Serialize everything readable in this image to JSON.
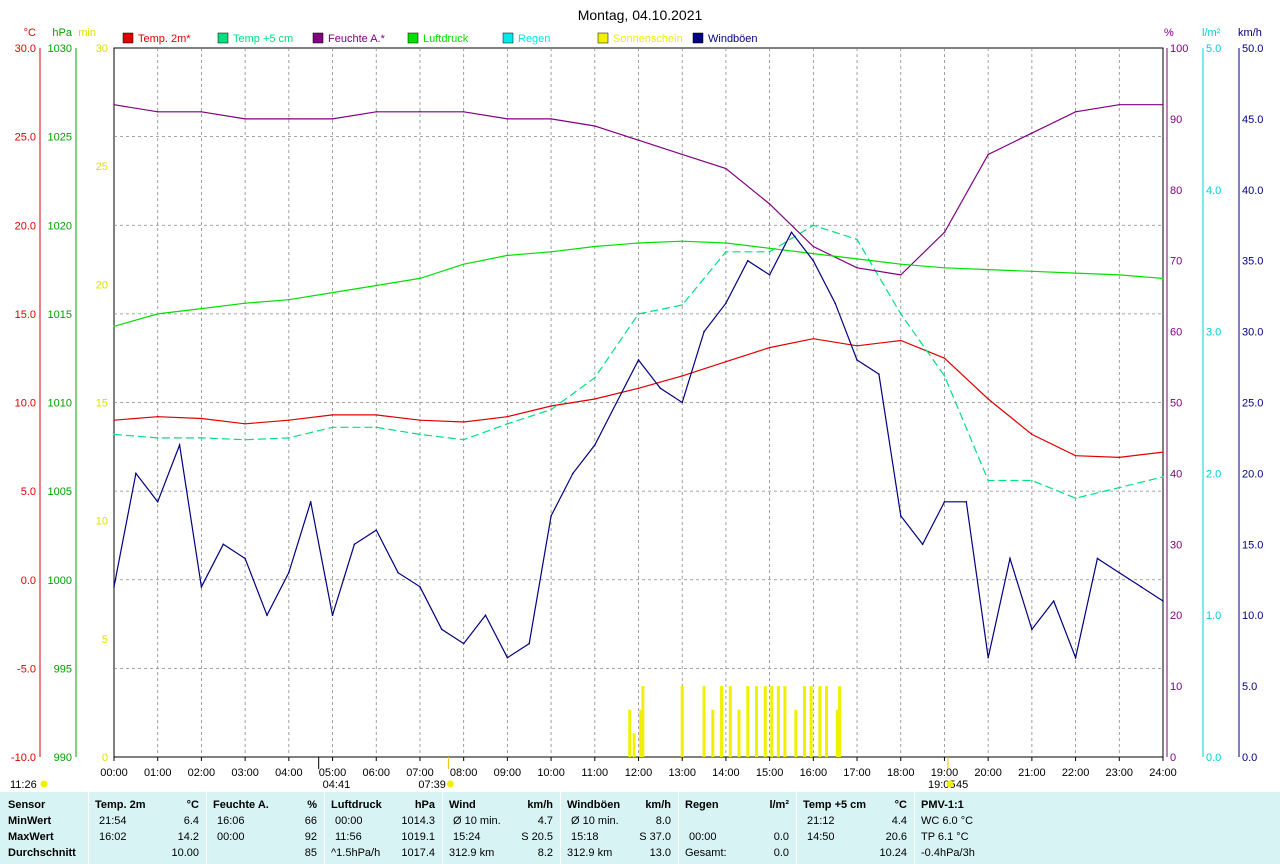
{
  "title": "Montag, 04.10.2021",
  "legend": [
    {
      "label": "Temp. 2m*",
      "color": "#e00000"
    },
    {
      "label": "Temp +5 cm",
      "color": "#00e080"
    },
    {
      "label": "Feuchte A.*",
      "color": "#800080"
    },
    {
      "label": "Luftdruck",
      "color": "#00e000"
    },
    {
      "label": "Regen",
      "color": "#00e8e8"
    },
    {
      "label": "Sonnenschein",
      "color": "#f0f000"
    },
    {
      "label": "Windböen",
      "color": "#000080"
    }
  ],
  "axes": {
    "temp": {
      "unit": "°C",
      "ticks": [
        "30.0",
        "25.0",
        "20.0",
        "15.0",
        "10.0",
        "5.0",
        "0.0",
        "-5.0",
        "-10.0"
      ],
      "color": "#e00000"
    },
    "pressure": {
      "unit": "hPa",
      "ticks": [
        "1030",
        "1025",
        "1020",
        "1015",
        "1010",
        "1005",
        "1000",
        "995",
        "990"
      ],
      "color": "#00a000"
    },
    "sun": {
      "unit": "min",
      "ticks": [
        "30",
        "25",
        "20",
        "15",
        "10",
        "5",
        "0"
      ],
      "color": "#e0e000"
    },
    "humidity": {
      "unit": "%",
      "ticks": [
        "100",
        "90",
        "80",
        "70",
        "60",
        "50",
        "40",
        "30",
        "20",
        "10",
        "0"
      ],
      "color": "#800080"
    },
    "rain": {
      "unit": "l/m²",
      "ticks": [
        "5.0",
        "4.0",
        "3.0",
        "2.0",
        "1.0",
        "0.0"
      ],
      "color": "#00d0d0"
    },
    "wind": {
      "unit": "km/h",
      "ticks": [
        "50.0",
        "45.0",
        "40.0",
        "35.0",
        "30.0",
        "25.0",
        "20.0",
        "15.0",
        "10.0",
        "5.0",
        "0.0"
      ],
      "color": "#000080"
    }
  },
  "x_labels": [
    "00:00",
    "01:00",
    "02:00",
    "03:00",
    "04:00",
    "05:00",
    "06:00",
    "07:00",
    "08:00",
    "09:00",
    "10:00",
    "11:00",
    "12:00",
    "13:00",
    "14:00",
    "15:00",
    "16:00",
    "17:00",
    "18:00",
    "19:00",
    "20:00",
    "21:00",
    "22:00",
    "23:00",
    "24:00"
  ],
  "sun_times": {
    "sunrise_label": "07:39",
    "sunset_label": "19:05",
    "moonrise_label": "04:41",
    "moonset_label": "45",
    "daylength_label": "11:26"
  },
  "chart_data": {
    "type": "line",
    "x_unit": "hour",
    "xlim": [
      0,
      24
    ],
    "series": [
      {
        "name": "Temp. 2m*",
        "axis": "temp",
        "x": [
          0,
          1,
          2,
          3,
          4,
          5,
          6,
          7,
          8,
          9,
          10,
          11,
          12,
          13,
          14,
          15,
          16,
          17,
          18,
          19,
          20,
          21,
          22,
          23,
          24
        ],
        "values": [
          9.0,
          9.2,
          9.1,
          8.8,
          9.0,
          9.3,
          9.3,
          9.0,
          8.9,
          9.2,
          9.8,
          10.2,
          10.8,
          11.5,
          12.3,
          13.1,
          13.6,
          13.2,
          13.5,
          12.5,
          10.2,
          8.2,
          7.0,
          6.9,
          7.2
        ]
      },
      {
        "name": "Temp +5 cm",
        "axis": "temp",
        "x": [
          0,
          1,
          2,
          3,
          4,
          5,
          6,
          7,
          8,
          9,
          10,
          11,
          12,
          13,
          14,
          15,
          16,
          17,
          18,
          19,
          20,
          21,
          22,
          23,
          24
        ],
        "values": [
          8.2,
          8.0,
          8.0,
          7.9,
          8.0,
          8.6,
          8.6,
          8.2,
          7.9,
          8.8,
          9.6,
          11.4,
          15.0,
          15.5,
          18.5,
          18.5,
          20.0,
          19.2,
          15.0,
          11.5,
          5.6,
          5.6,
          4.6,
          5.2,
          5.8
        ]
      },
      {
        "name": "Feuchte A.*",
        "axis": "humidity",
        "x": [
          0,
          1,
          2,
          3,
          4,
          5,
          6,
          7,
          8,
          9,
          10,
          11,
          12,
          13,
          14,
          15,
          16,
          17,
          18,
          19,
          20,
          21,
          22,
          23,
          24
        ],
        "values": [
          92,
          91,
          91,
          90,
          90,
          90,
          91,
          91,
          91,
          90,
          90,
          89,
          87,
          85,
          83,
          78,
          72,
          69,
          68,
          74,
          85,
          88,
          91,
          92,
          92
        ]
      },
      {
        "name": "Luftdruck",
        "axis": "pressure",
        "x": [
          0,
          1,
          2,
          3,
          4,
          5,
          6,
          7,
          8,
          9,
          10,
          11,
          12,
          13,
          14,
          15,
          16,
          17,
          18,
          19,
          20,
          21,
          22,
          23,
          24
        ],
        "values": [
          1014.3,
          1015.0,
          1015.3,
          1015.6,
          1015.8,
          1016.2,
          1016.6,
          1017.0,
          1017.8,
          1018.3,
          1018.5,
          1018.8,
          1019.0,
          1019.1,
          1019.0,
          1018.7,
          1018.4,
          1018.1,
          1017.8,
          1017.6,
          1017.5,
          1017.4,
          1017.3,
          1017.2,
          1017.0
        ]
      },
      {
        "name": "Windböen",
        "axis": "wind",
        "x": [
          0,
          0.5,
          1,
          1.5,
          2,
          2.5,
          3,
          3.5,
          4,
          4.5,
          5,
          5.5,
          6,
          6.5,
          7,
          7.5,
          8,
          8.5,
          9,
          9.5,
          10,
          10.5,
          11,
          11.5,
          12,
          12.5,
          13,
          13.5,
          14,
          14.5,
          15,
          15.5,
          16,
          16.5,
          17,
          17.5,
          18,
          18.5,
          19,
          19.5,
          20,
          20.5,
          21,
          21.5,
          22,
          22.5,
          23,
          23.5,
          24
        ],
        "values": [
          12,
          20,
          18,
          22,
          12,
          15,
          14,
          10,
          13,
          18,
          10,
          15,
          16,
          13,
          12,
          9,
          8,
          10,
          7,
          8,
          17,
          20,
          22,
          25,
          28,
          26,
          25,
          30,
          32,
          35,
          34,
          37,
          35,
          32,
          28,
          27,
          17,
          15,
          18,
          18,
          7,
          14,
          9,
          11,
          7,
          14,
          13,
          12,
          11
        ]
      }
    ],
    "sunshine_minutes": {
      "x": [
        11.8,
        11.9,
        12.05,
        12.1,
        13.0,
        13.5,
        13.7,
        13.9,
        14.1,
        14.3,
        14.5,
        14.7,
        14.9,
        15.05,
        15.2,
        15.35,
        15.6,
        15.8,
        15.95,
        16.15,
        16.3,
        16.55,
        16.6
      ],
      "values": [
        2,
        1,
        2,
        3,
        3,
        3,
        2,
        3,
        3,
        2,
        3,
        3,
        3,
        3,
        3,
        3,
        2,
        3,
        3,
        3,
        3,
        2,
        3
      ]
    },
    "ylim_temp": [
      -10,
      30
    ],
    "ylim_pressure": [
      990,
      1030
    ],
    "ylim_humidity": [
      0,
      100
    ],
    "ylim_wind": [
      0,
      50
    ],
    "ylim_rain": [
      0,
      5
    ],
    "ylim_sun": [
      0,
      30
    ],
    "grid": true
  },
  "stats": {
    "row_labels": [
      "Sensor",
      "MinWert",
      "MaxWert",
      "Durchschnitt"
    ],
    "columns": [
      {
        "name": "Temp. 2m",
        "unit": "°C",
        "min_time": "21:54",
        "min": "6.4",
        "max_time": "16:02",
        "max": "14.2",
        "avg_label": "",
        "avg": "10.00"
      },
      {
        "name": "Feuchte A.",
        "unit": "%",
        "min_time": "16:06",
        "min": "66",
        "max_time": "00:00",
        "max": "92",
        "avg_label": "",
        "avg": "85"
      },
      {
        "name": "Luftdruck",
        "unit": "hPa",
        "min_time": "00:00",
        "min": "1014.3",
        "max_time": "11:56",
        "max": "1019.1",
        "avg_label": "^1.5hPa/h",
        "avg": "1017.4"
      },
      {
        "name": "Wind",
        "unit": "km/h",
        "min_time": "Ø 10 min.",
        "min": "4.7",
        "max_time": "15:24",
        "max": "S 20.5",
        "avg_label": "312.9 km",
        "avg": "8.2"
      },
      {
        "name": "Windböen",
        "unit": "km/h",
        "min_time": "Ø 10 min.",
        "min": "8.0",
        "max_time": "15:18",
        "max": "S 37.0",
        "avg_label": "312.9 km",
        "avg": "13.0"
      },
      {
        "name": "Regen",
        "unit": "l/m²",
        "min_time": "",
        "min": "",
        "max_time": "00:00",
        "max": "0.0",
        "avg_label": "Gesamt:",
        "avg": "0.0"
      },
      {
        "name": "Temp +5 cm",
        "unit": "°C",
        "min_time": "21:12",
        "min": "4.4",
        "max_time": "14:50",
        "max": "20.6",
        "avg_label": "",
        "avg": "10.24"
      }
    ],
    "pmv": {
      "name": "PMV-1:1",
      "line1": "WC 6.0 °C",
      "line2": "TP 6.1 °C",
      "line3": "-0.4hPa/3h"
    }
  }
}
